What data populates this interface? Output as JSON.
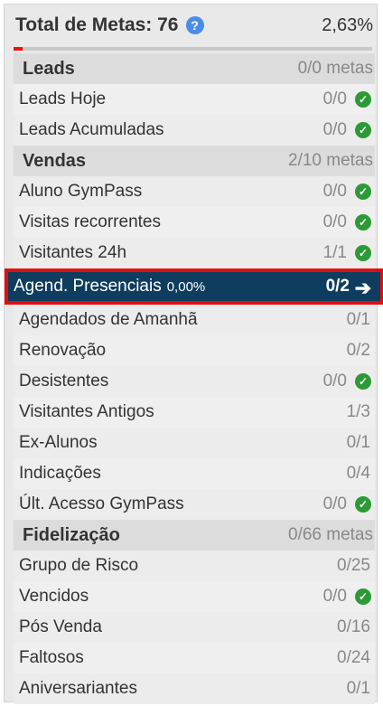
{
  "header": {
    "title": "Total de Metas: 76",
    "percent": "2,63%",
    "progress_fraction": 0.0263,
    "help_icon": "question-circle-icon"
  },
  "colors": {
    "accent": "#0e3d5f",
    "highlight_border": "#e10f0f",
    "check": "#2c9a35",
    "help": "#4a8de8"
  },
  "sections": [
    {
      "title": "Leads",
      "metas": "0/0 metas",
      "items": [
        {
          "label": "Leads Hoje",
          "value": "0/0",
          "done": true
        },
        {
          "label": "Leads Acumuladas",
          "value": "0/0",
          "done": true
        }
      ]
    },
    {
      "title": "Vendas",
      "metas": "2/10 metas",
      "items": [
        {
          "label": "Aluno GymPass",
          "value": "0/0",
          "done": true
        },
        {
          "label": "Visitas recorrentes",
          "value": "0/0",
          "done": true
        },
        {
          "label": "Visitantes 24h",
          "value": "1/1",
          "done": true
        },
        {
          "label": "Agend. Presenciais",
          "pct": "0,00%",
          "value": "0/2",
          "active": true
        },
        {
          "label": "Agendados de Amanhã",
          "value": "0/1"
        },
        {
          "label": "Renovação",
          "value": "0/2"
        },
        {
          "label": "Desistentes",
          "value": "0/0",
          "done": true
        },
        {
          "label": "Visitantes Antigos",
          "value": "1/3"
        },
        {
          "label": "Ex-Alunos",
          "value": "0/1"
        },
        {
          "label": "Indicações",
          "value": "0/4"
        },
        {
          "label": "Últ. Acesso GymPass",
          "value": "0/0",
          "done": true
        }
      ]
    },
    {
      "title": "Fidelização",
      "metas": "0/66 metas",
      "items": [
        {
          "label": "Grupo de Risco",
          "value": "0/25"
        },
        {
          "label": "Vencidos",
          "value": "0/0",
          "done": true
        },
        {
          "label": "Pós Venda",
          "value": "0/16"
        },
        {
          "label": "Faltosos",
          "value": "0/24"
        },
        {
          "label": "Aniversariantes",
          "value": "0/1"
        }
      ]
    }
  ]
}
